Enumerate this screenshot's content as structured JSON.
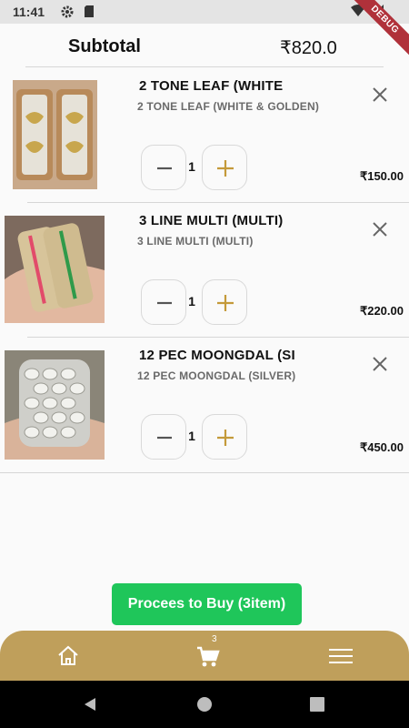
{
  "status_bar": {
    "time": "11:41",
    "debug_label": "DEBUG"
  },
  "summary": {
    "subtotal_label": "Subtotal",
    "subtotal_value": "₹820.0"
  },
  "cart_items": [
    {
      "title": "2 TONE LEAF (WHITE",
      "subtitle": "2 TONE LEAF (WHITE & GOLDEN)",
      "quantity": "1",
      "price": "₹150.00"
    },
    {
      "title": "3 LINE MULTI (MULTI)",
      "subtitle": "3 LINE MULTI (MULTI)",
      "quantity": "1",
      "price": "₹220.00"
    },
    {
      "title": "12 PEC MOONGDAL (SI",
      "subtitle": "12 PEC MOONGDAL (SILVER)",
      "quantity": "1",
      "price": "₹450.00"
    }
  ],
  "checkout": {
    "button_label": "Procees to Buy (3item)"
  },
  "bottom_nav": {
    "cart_badge": "3",
    "items": [
      "home-icon",
      "cart-icon",
      "menu-icon"
    ]
  },
  "colors": {
    "accent": "#bf9f5b",
    "proceed_button": "#1fc65a",
    "stepper_plus": "#c49a3a",
    "ribbon": "#b0313a"
  }
}
